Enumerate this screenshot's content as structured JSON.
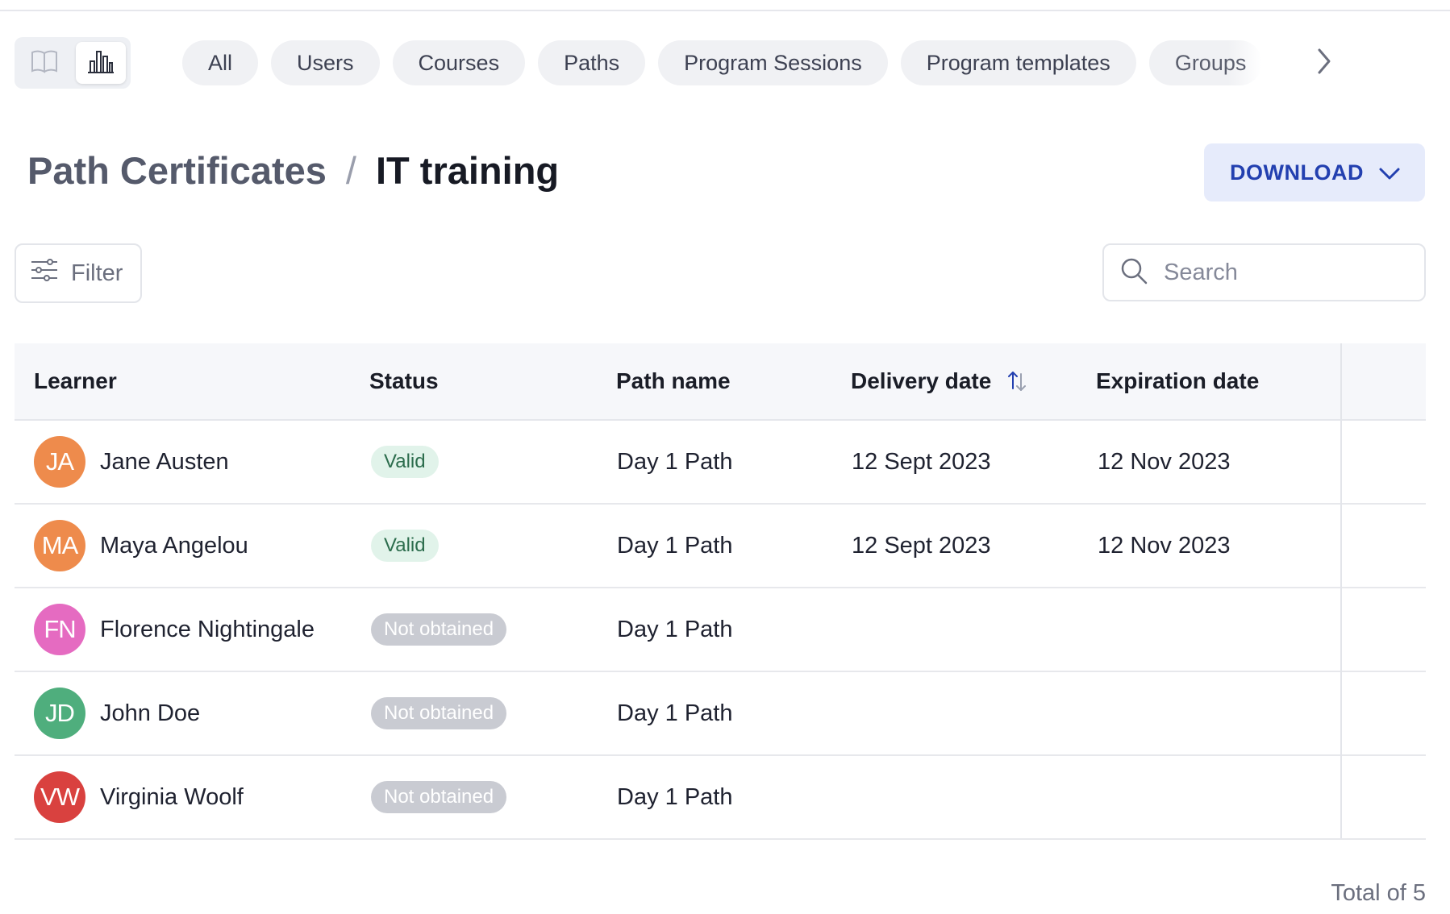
{
  "tabs": [
    "All",
    "Users",
    "Courses",
    "Paths",
    "Program Sessions",
    "Program templates",
    "Groups"
  ],
  "breadcrumb": {
    "parent": "Path Certificates",
    "separator": "/",
    "current": "IT training"
  },
  "download_label": "DOWNLOAD",
  "filter_label": "Filter",
  "search": {
    "placeholder": "Search"
  },
  "columns": {
    "learner": "Learner",
    "status": "Status",
    "path_name": "Path name",
    "delivery_date": "Delivery date",
    "expiration_date": "Expiration date"
  },
  "rows": [
    {
      "initials": "JA",
      "name": "Jane Austen",
      "avatar_color": "#ee8b4c",
      "status": "Valid",
      "status_kind": "valid",
      "path": "Day 1 Path",
      "delivery": "12 Sept 2023",
      "expiration": "12 Nov 2023"
    },
    {
      "initials": "MA",
      "name": "Maya Angelou",
      "avatar_color": "#ee8b4c",
      "status": "Valid",
      "status_kind": "valid",
      "path": "Day 1 Path",
      "delivery": "12 Sept 2023",
      "expiration": "12 Nov 2023"
    },
    {
      "initials": "FN",
      "name": "Florence Nightingale",
      "avatar_color": "#e56bc1",
      "status": "Not obtained",
      "status_kind": "notobt",
      "path": "Day 1 Path",
      "delivery": "",
      "expiration": ""
    },
    {
      "initials": "JD",
      "name": "John Doe",
      "avatar_color": "#4fae7d",
      "status": "Not obtained",
      "status_kind": "notobt",
      "path": "Day 1 Path",
      "delivery": "",
      "expiration": ""
    },
    {
      "initials": "VW",
      "name": "Virginia Woolf",
      "avatar_color": "#d9413f",
      "status": "Not obtained",
      "status_kind": "notobt",
      "path": "Day 1 Path",
      "delivery": "",
      "expiration": ""
    }
  ],
  "total_label": "Total of 5",
  "colors": {
    "accent": "#2340b0",
    "valid_bg": "#e1f3ea",
    "not_obtained_bg": "#c9cbd2"
  },
  "icons": {
    "view_left": "book-icon",
    "view_right": "bar-chart-icon",
    "tabs_next": "chevron-right-icon",
    "download": "chevron-down-icon",
    "filter": "sliders-icon",
    "search": "search-icon",
    "sort": "sort-icon"
  }
}
